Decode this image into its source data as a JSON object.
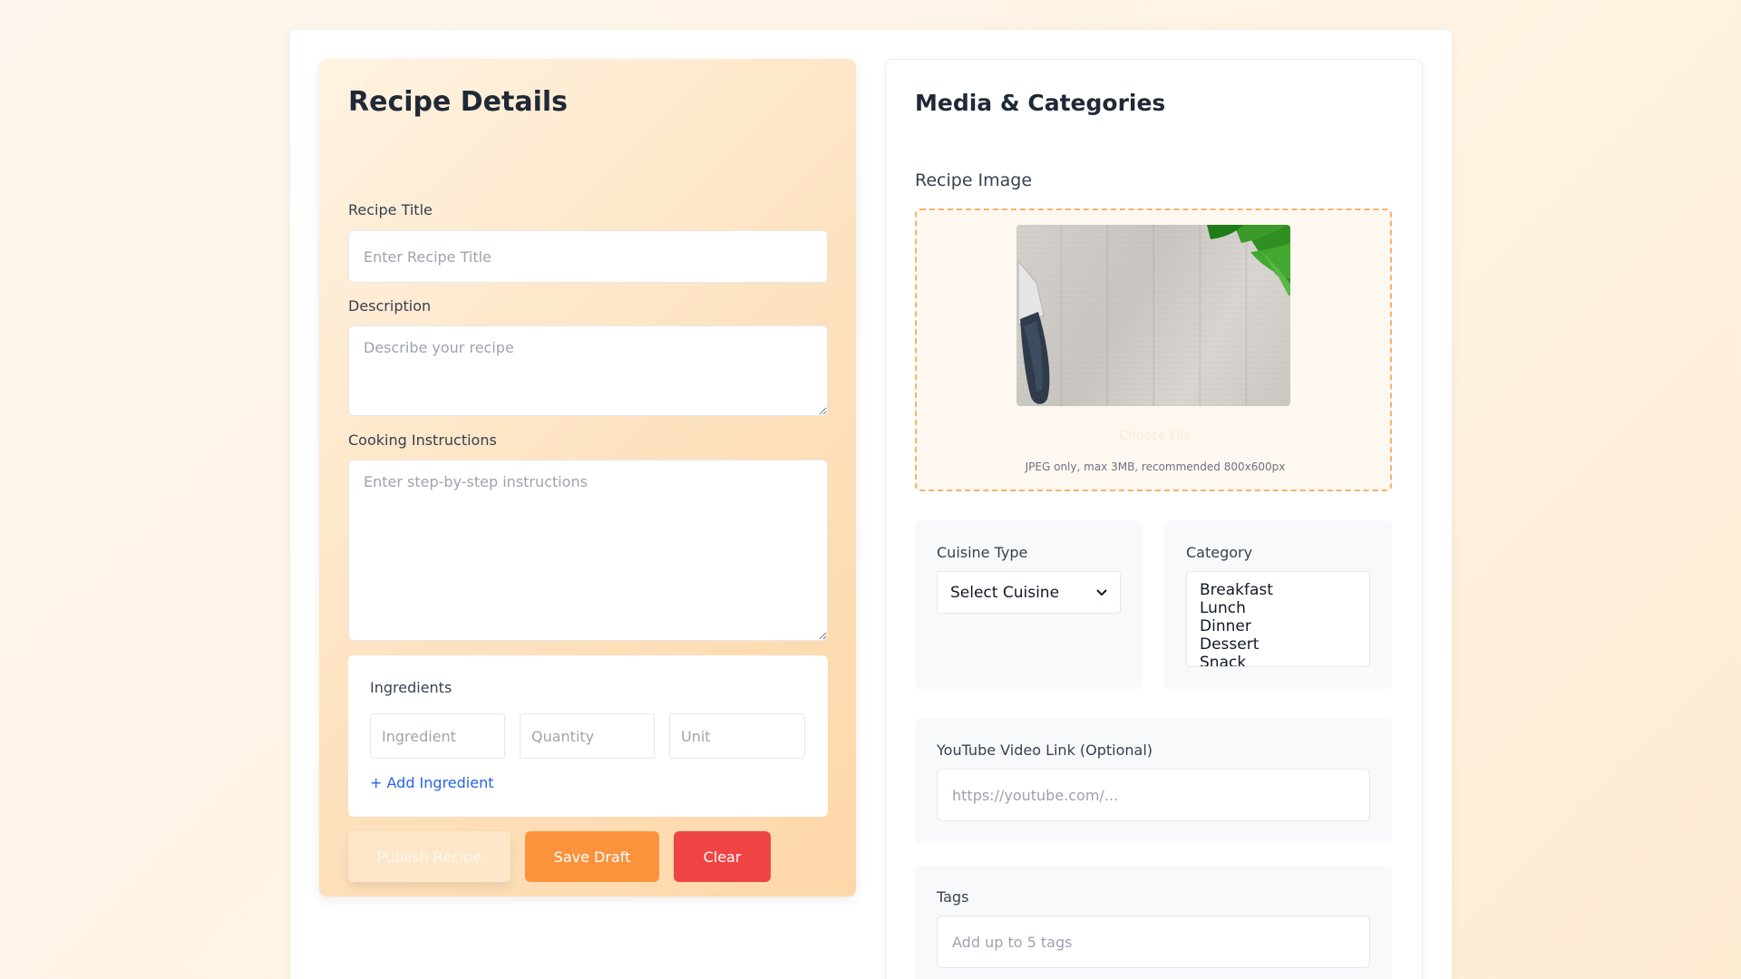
{
  "details": {
    "heading": "Recipe Details",
    "title_label": "Recipe Title",
    "title_placeholder": "Enter Recipe Title",
    "description_label": "Description",
    "description_placeholder": "Describe your recipe",
    "instructions_label": "Cooking Instructions",
    "instructions_placeholder": "Enter step-by-step instructions",
    "ingredients": {
      "label": "Ingredients",
      "ingredient_placeholder": "Ingredient",
      "quantity_placeholder": "Quantity",
      "unit_placeholder": "Unit",
      "add_label": "+ Add Ingredient"
    },
    "buttons": {
      "publish": "Publish Recipe",
      "draft": "Save Draft",
      "clear": "Clear"
    }
  },
  "media": {
    "heading": "Media & Categories",
    "image_label": "Recipe Image",
    "choose_file": "Choose File",
    "image_hint": "JPEG only, max 3MB, recommended 800x600px",
    "cuisine": {
      "label": "Cuisine Type",
      "selected": "Select Cuisine"
    },
    "category": {
      "label": "Category",
      "options": [
        "Breakfast",
        "Lunch",
        "Dinner",
        "Dessert",
        "Snack"
      ]
    },
    "youtube": {
      "label": "YouTube Video Link (Optional)",
      "placeholder": "https://youtube.com/..."
    },
    "tags": {
      "label": "Tags",
      "placeholder": "Add up to 5 tags"
    }
  },
  "colors": {
    "accent_orange": "#fb923c",
    "danger_red": "#ef4444",
    "link_blue": "#2563eb"
  }
}
